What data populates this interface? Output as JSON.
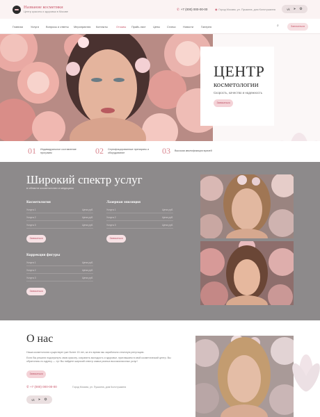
{
  "header": {
    "brand_name": "Название косметики",
    "brand_sub": "Центр красоты и здоровья в Москве",
    "phone": "+7 (000) 000-00-00",
    "address": "Город Москва, ул. Пушкина, дом Колотушкина",
    "social": [
      "vk",
      "tg",
      "ok"
    ]
  },
  "nav": {
    "items": [
      "Главная",
      "Услуги",
      "Вопросы и ответы",
      "Мероприятия",
      "Контакты",
      "Отзывы",
      "Прайс-лист",
      "Цены",
      "Статьи",
      "Новости",
      "Галерея"
    ],
    "active_index": 5,
    "button": "Записаться"
  },
  "hero": {
    "title": "ЦЕНТР",
    "subtitle": "косметологии",
    "tagline": "Скорость, качество и надежность",
    "button": "Записаться"
  },
  "features": [
    {
      "num": "01",
      "text": "Индивидуальное составление программ"
    },
    {
      "num": "02",
      "text": "Сертифицированные препараты и оборудование"
    },
    {
      "num": "03",
      "text": "Высокая квалификация врачей"
    }
  ],
  "services": {
    "title": "Широкий спектр услуг",
    "subtitle": "в области косметологии и медицины",
    "categories": [
      {
        "name": "Косметология",
        "rows": [
          {
            "name": "Услуга 1",
            "price": "Цена руб."
          },
          {
            "name": "Услуга 2",
            "price": "Цена руб."
          },
          {
            "name": "Услуга 3",
            "price": "Цена руб."
          }
        ],
        "button": "Записаться"
      },
      {
        "name": "Лазерная эпиляция",
        "rows": [
          {
            "name": "Услуга 1",
            "price": "Цена руб."
          },
          {
            "name": "Услуга 2",
            "price": "Цена руб."
          },
          {
            "name": "Услуга 3",
            "price": "Цена руб."
          }
        ],
        "button": "Записаться"
      },
      {
        "name": "Коррекция фигуры",
        "rows": [
          {
            "name": "Услуга 1",
            "price": "Цена руб."
          },
          {
            "name": "Услуга 2",
            "price": "Цена руб."
          },
          {
            "name": "Услуга 3",
            "price": "Цена руб."
          }
        ],
        "button": "Записаться"
      }
    ]
  },
  "about": {
    "title": "О нас",
    "p1": "Наша косметология существует уже более 15 лет, за это время мы заработали отличную репутацию.",
    "p2": "Если Вы решили подчеркнуть свою красоту, сохранить молодость и здоровье, приглашаем в свой косметический центр. Вы обратились по адресу — тут Вы найдете широкий спектр самых разных высококлассных услуг!",
    "button": "Записаться",
    "phone": "+7 (000) 000-00-00",
    "address": "Город Москва, ул. Пушкина, дом Колотушкина",
    "social": [
      "vk",
      "tg",
      "ok"
    ]
  },
  "colors": {
    "accent": "#c9576a",
    "services_bg": "#8d8a8b",
    "button_bg": "#f4d2d7"
  }
}
